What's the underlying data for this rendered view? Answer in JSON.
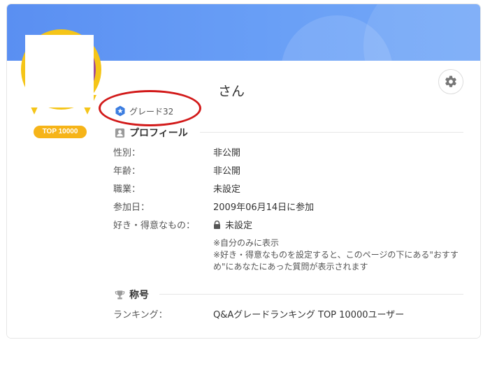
{
  "header": {
    "user_name_suffix": "さん",
    "grade_label": "グレード32",
    "rank_badge": "TOP 10000"
  },
  "profile": {
    "title": "プロフィール",
    "rows": [
      {
        "label": "性別：",
        "value": "非公開"
      },
      {
        "label": "年齢：",
        "value": "非公開"
      },
      {
        "label": "職業：",
        "value": "未設定"
      },
      {
        "label": "参加日：",
        "value": "2009年06月14日に参加"
      },
      {
        "label": "好き・得意なもの：",
        "value": "未設定"
      }
    ],
    "note_private": "※自分のみに表示",
    "note_hint_line1": "※好き・得意なものを設定すると、このページの下にある\"おすす",
    "note_hint_line2": "め\"にあなたにあった質問が表示されます"
  },
  "titles": {
    "title": "称号",
    "ranking_label": "ランキング：",
    "ranking_value": "Q&Aグレードランキング TOP 10000ユーザー"
  },
  "colors": {
    "banner": "#5a8ff2",
    "medal_gold": "#f5c518",
    "annotation_red": "#d21a1a",
    "grade_blue": "#3b7de0"
  },
  "icons": {
    "settings": "gear-icon",
    "grade": "grade-star-hexagon-icon",
    "profile": "profile-card-icon",
    "titles": "trophy-icon",
    "private": "lock-icon"
  }
}
